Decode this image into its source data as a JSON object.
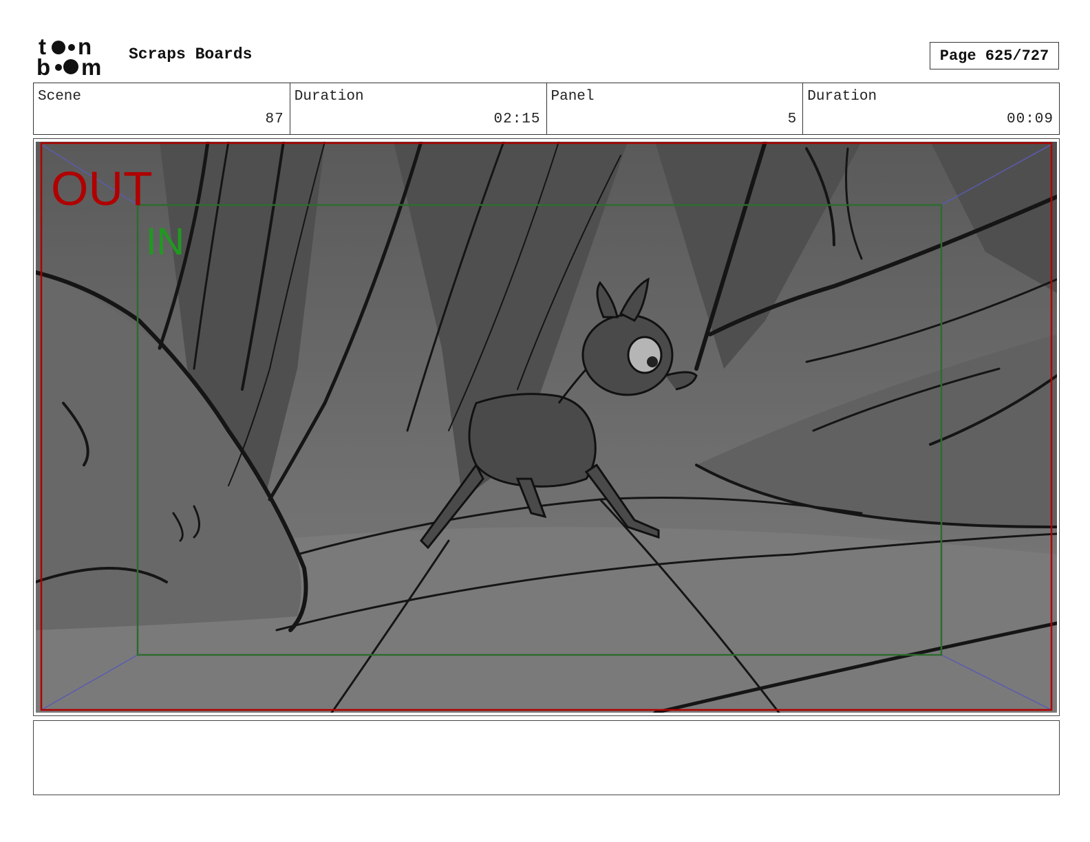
{
  "header": {
    "logo_text_top": "toon",
    "logo_text_bottom": "boom",
    "title": "Scraps Boards",
    "page": "Page 625/727"
  },
  "info": [
    {
      "label": "Scene",
      "value": "87"
    },
    {
      "label": "Duration",
      "value": "02:15"
    },
    {
      "label": "Panel",
      "value": "5"
    },
    {
      "label": "Duration",
      "value": "00:09"
    }
  ],
  "panel": {
    "out_label": "OUT",
    "in_label": "IN",
    "colors": {
      "out": "#b00000",
      "in": "#1f9a1f",
      "safe_frame": "#2f6b2f",
      "guides": "#5b5bb0"
    }
  },
  "notes": ""
}
